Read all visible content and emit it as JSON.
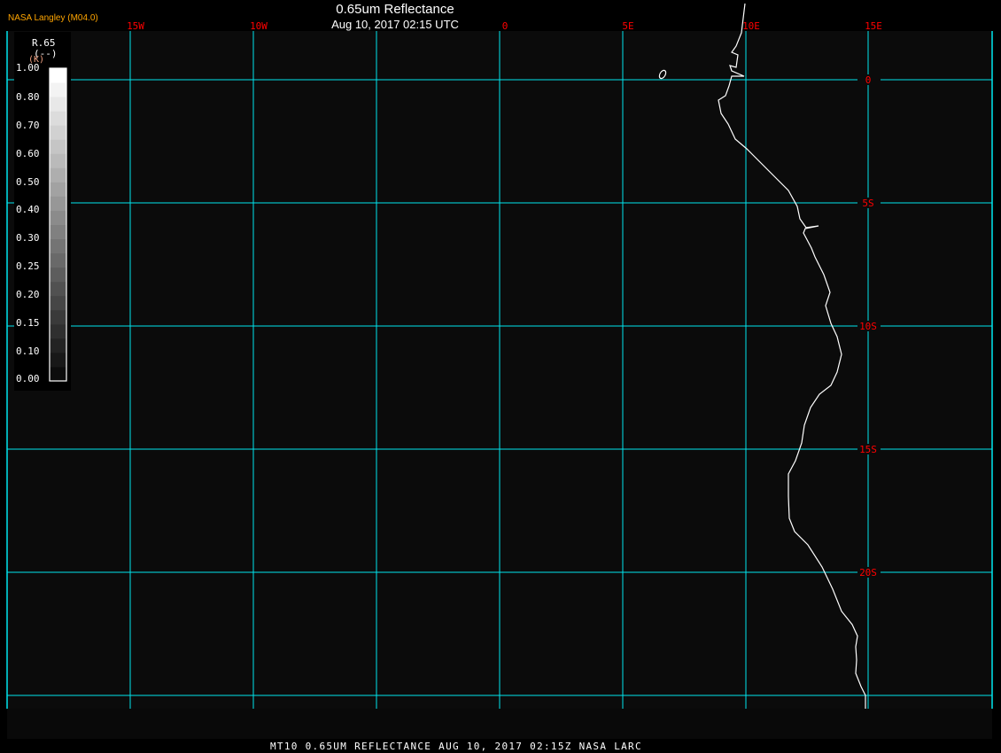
{
  "header": {
    "title": "0.65um Reflectance",
    "subtitle": "Aug 10, 2017 02:15 UTC",
    "producer": "NASA Langley (M04.0)"
  },
  "footer": {
    "text": "MT10  0.65UM REFLECTANCE   AUG 10, 2017 02:15Z   NASA LARC"
  },
  "legend": {
    "parameter": "R.65",
    "unit": "(--)",
    "unit_overlay": "(K)",
    "ticks": [
      "1.00",
      "0.80",
      "0.70",
      "0.60",
      "0.50",
      "0.40",
      "0.30",
      "0.25",
      "0.20",
      "0.15",
      "0.10",
      "0.00"
    ],
    "range": [
      0,
      1
    ],
    "colormap": "grayscale"
  },
  "map": {
    "longitude_labels": [
      "15W",
      "10W",
      "0",
      "5E",
      "10E",
      "15E"
    ],
    "latitude_labels": [
      "0",
      "5S",
      "10S",
      "15S",
      "20S"
    ],
    "grid_color": "#00e5ee",
    "label_color": "#ff0000",
    "coastline_color": "#ffffff",
    "background": "#0b0b0b"
  }
}
